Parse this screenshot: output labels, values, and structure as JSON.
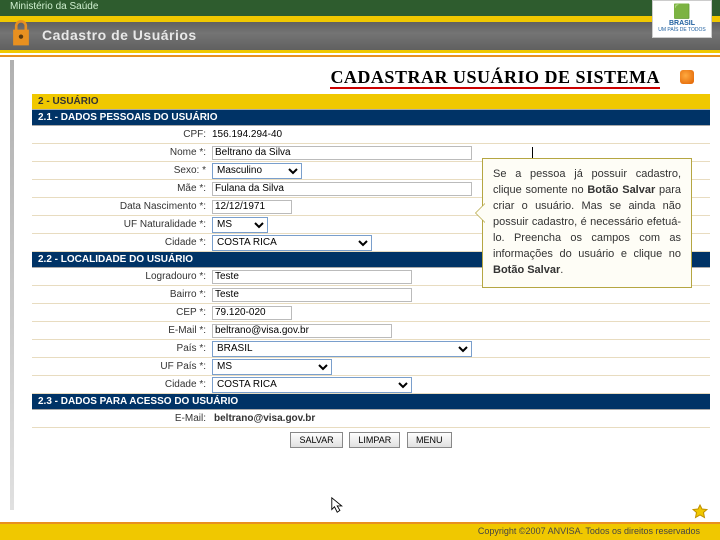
{
  "header": {
    "org": "Ministério da Saúde",
    "app_title": "Cadastro de Usuários",
    "brasil": "BRASIL",
    "brasil_sub": "UM PAÍS DE TODOS"
  },
  "page_title": "CADASTRAR USUÁRIO DE SISTEMA",
  "section2": {
    "title": "2 - USUÁRIO"
  },
  "section21": {
    "title": "2.1 - DADOS PESSOAIS DO USUÁRIO",
    "cpf_label": "CPF:",
    "cpf_value": "156.194.294-40",
    "nome_label": "Nome *:",
    "nome_value": "Beltrano da Silva",
    "sexo_label": "Sexo: *",
    "sexo_value": "Masculino",
    "mae_label": "Mãe *:",
    "mae_value": "Fulana da Silva",
    "datanasc_label": "Data Nascimento *:",
    "datanasc_value": "12/12/1971",
    "uf_nat_label": "UF Naturalidade *:",
    "uf_nat_value": "MS",
    "cidade_label": "Cidade *:",
    "cidade_value": "COSTA RICA"
  },
  "section22": {
    "title": "2.2 - LOCALIDADE DO USUÁRIO",
    "logradouro_label": "Logradouro *:",
    "logradouro_value": "Teste",
    "bairro_label": "Bairro *:",
    "bairro_value": "Teste",
    "cep_label": "CEP *:",
    "cep_value": "79.120-020",
    "email_label": "E-Mail *:",
    "email_value": "beltrano@visa.gov.br",
    "pais_label": "País *:",
    "pais_value": "BRASIL",
    "uf_pais_label": "UF País *:",
    "uf_pais_value": "MS",
    "cidade_label": "Cidade *:",
    "cidade_value": "COSTA RICA"
  },
  "section23": {
    "title": "2.3 - DADOS PARA ACESSO DO USUÁRIO",
    "email_label": "E-Mail:",
    "email_value": "beltrano@visa.gov.br"
  },
  "buttons": {
    "salvar": "SALVAR",
    "limpar": "LIMPAR",
    "menu": "MENU"
  },
  "callout": {
    "text1": "Se a pessoa já possuir cadastro, clique somente no ",
    "bold1": "Botão Salvar",
    "text2": " para criar o usuário. Mas se ainda não possuir cadastro, é necessário efetuá-lo. Preencha os campos com as informações do usuário e clique no ",
    "bold2": "Botão Salvar",
    "text3": "."
  },
  "footer": "Copyright ©2007 ANVISA. Todos os direitos reservados"
}
